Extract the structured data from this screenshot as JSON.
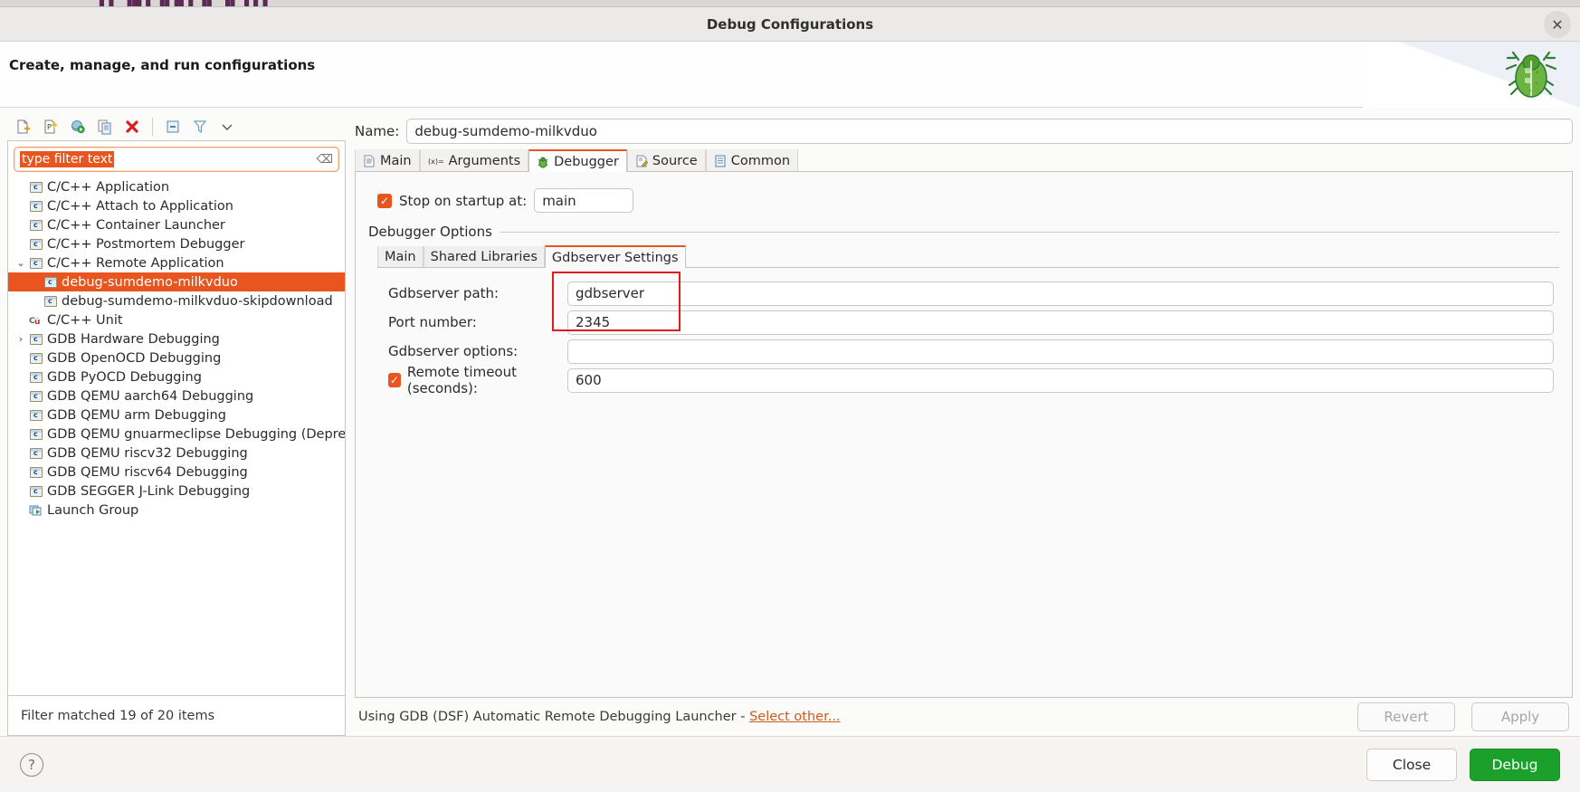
{
  "window": {
    "title": "Debug Configurations",
    "close_icon": "close-icon",
    "headline": "Create, manage, and run configurations",
    "bug_icon": "bug-icon"
  },
  "toolbar": {
    "buttons": [
      {
        "name": "new-launch-configuration",
        "icon": "new-file-icon"
      },
      {
        "name": "new-launch-configuration-prototype",
        "icon": "new-prototype-icon"
      },
      {
        "name": "export-launch-configuration",
        "icon": "export-icon"
      },
      {
        "name": "duplicate-launch-configuration",
        "icon": "duplicate-icon"
      },
      {
        "name": "delete-launch-configuration",
        "icon": "delete-icon"
      },
      {
        "name": "collapse-all",
        "icon": "collapse-all-icon"
      },
      {
        "name": "filter-launch-configurations",
        "icon": "filter-icon"
      },
      {
        "name": "view-menu",
        "icon": "chevron-down-icon"
      }
    ]
  },
  "filter": {
    "text": "type filter text",
    "clear_icon": "clear-icon",
    "status": "Filter matched 19 of 20 items"
  },
  "tree": {
    "items": [
      {
        "label": "C/C++ Application",
        "indent": 1,
        "twisty": "",
        "icon": "c-launch-icon",
        "selected": false
      },
      {
        "label": "C/C++ Attach to Application",
        "indent": 1,
        "twisty": "",
        "icon": "c-launch-icon",
        "selected": false
      },
      {
        "label": "C/C++ Container Launcher",
        "indent": 1,
        "twisty": "",
        "icon": "c-launch-icon",
        "selected": false
      },
      {
        "label": "C/C++ Postmortem Debugger",
        "indent": 1,
        "twisty": "",
        "icon": "c-launch-icon",
        "selected": false
      },
      {
        "label": "C/C++ Remote Application",
        "indent": 1,
        "twisty": "expanded",
        "icon": "c-launch-icon",
        "selected": false
      },
      {
        "label": "debug-sumdemo-milkvduo",
        "indent": 2,
        "twisty": "",
        "icon": "c-launch-icon",
        "selected": true
      },
      {
        "label": "debug-sumdemo-milkvduo-skipdownload",
        "indent": 2,
        "twisty": "",
        "icon": "c-launch-icon",
        "selected": false
      },
      {
        "label": "C/C++ Unit",
        "indent": 1,
        "twisty": "",
        "icon": "cunit-icon",
        "selected": false
      },
      {
        "label": "GDB Hardware Debugging",
        "indent": 1,
        "twisty": "collapsed",
        "icon": "c-launch-icon",
        "selected": false
      },
      {
        "label": "GDB OpenOCD Debugging",
        "indent": 1,
        "twisty": "",
        "icon": "c-launch-icon",
        "selected": false
      },
      {
        "label": "GDB PyOCD Debugging",
        "indent": 1,
        "twisty": "",
        "icon": "c-launch-icon",
        "selected": false
      },
      {
        "label": "GDB QEMU aarch64 Debugging",
        "indent": 1,
        "twisty": "",
        "icon": "c-launch-icon",
        "selected": false
      },
      {
        "label": "GDB QEMU arm Debugging",
        "indent": 1,
        "twisty": "",
        "icon": "c-launch-icon",
        "selected": false
      },
      {
        "label": "GDB QEMU gnuarmeclipse Debugging (Deprecated)",
        "indent": 1,
        "twisty": "",
        "icon": "c-launch-icon",
        "selected": false
      },
      {
        "label": "GDB QEMU riscv32 Debugging",
        "indent": 1,
        "twisty": "",
        "icon": "c-launch-icon",
        "selected": false
      },
      {
        "label": "GDB QEMU riscv64 Debugging",
        "indent": 1,
        "twisty": "",
        "icon": "c-launch-icon",
        "selected": false
      },
      {
        "label": "GDB SEGGER J-Link Debugging",
        "indent": 1,
        "twisty": "",
        "icon": "c-launch-icon",
        "selected": false
      },
      {
        "label": "Launch Group",
        "indent": 1,
        "twisty": "",
        "icon": "launch-group-icon",
        "selected": false
      }
    ]
  },
  "config": {
    "name_label": "Name:",
    "name_value": "debug-sumdemo-milkvduo",
    "tabs": [
      {
        "label": "Main",
        "icon": "document-icon",
        "active": false
      },
      {
        "label": "Arguments",
        "icon": "arguments-icon",
        "active": false
      },
      {
        "label": "Debugger",
        "icon": "bug-icon",
        "active": true
      },
      {
        "label": "Source",
        "icon": "source-icon",
        "active": false
      },
      {
        "label": "Common",
        "icon": "common-icon",
        "active": false
      }
    ],
    "stop_on_startup": {
      "label": "Stop on startup at:",
      "checked": true,
      "value": "main"
    },
    "group_title": "Debugger Options",
    "inner_tabs": [
      {
        "label": "Main",
        "active": false
      },
      {
        "label": "Shared Libraries",
        "active": false
      },
      {
        "label": "Gdbserver Settings",
        "active": true
      }
    ],
    "fields": [
      {
        "label": "Gdbserver path:",
        "value": "gdbserver",
        "checkbox": false,
        "name": "gdbserver-path"
      },
      {
        "label": "Port number:",
        "value": "2345",
        "checkbox": false,
        "name": "port-number"
      },
      {
        "label": "Gdbserver options:",
        "value": "",
        "checkbox": false,
        "name": "gdbserver-options"
      },
      {
        "label": "Remote timeout (seconds):",
        "value": "600",
        "checkbox": true,
        "checked": true,
        "name": "remote-timeout"
      }
    ],
    "annotation_color": "#e01b1b"
  },
  "launcher": {
    "text": "Using GDB (DSF) Automatic Remote Debugging Launcher -",
    "link": "Select other...",
    "revert": "Revert",
    "apply": "Apply"
  },
  "footer": {
    "help_icon": "help-icon",
    "close": "Close",
    "debug": "Debug",
    "debug_color": "#1ba02b"
  },
  "background": {
    "strip_text": "▌▌ ▐█ ▌▐▌█▐ ▐▌ ▐▌▐ ▌▌"
  }
}
